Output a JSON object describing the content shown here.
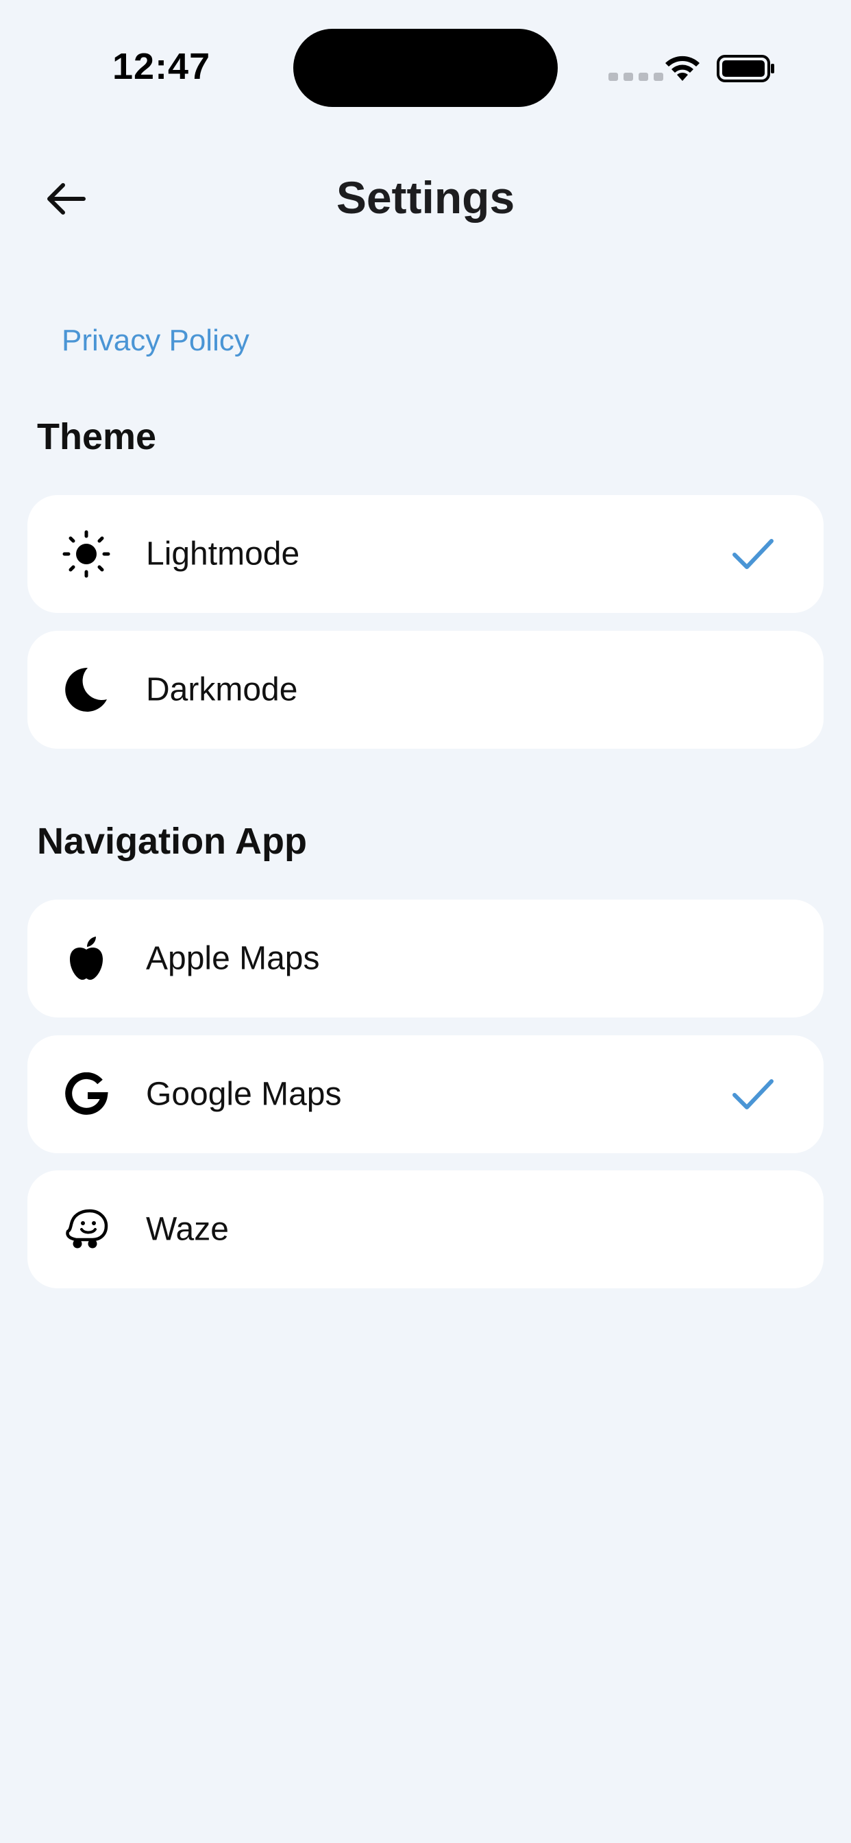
{
  "status_bar": {
    "time": "12:47"
  },
  "header": {
    "title": "Settings"
  },
  "privacy_policy": "Privacy Policy",
  "theme": {
    "title": "Theme",
    "options": [
      {
        "label": "Lightmode",
        "icon": "sun-icon",
        "selected": true
      },
      {
        "label": "Darkmode",
        "icon": "moon-icon",
        "selected": false
      }
    ]
  },
  "navigation": {
    "title": "Navigation App",
    "options": [
      {
        "label": "Apple Maps",
        "icon": "apple-icon",
        "selected": false
      },
      {
        "label": "Google Maps",
        "icon": "google-icon",
        "selected": true
      },
      {
        "label": "Waze",
        "icon": "waze-icon",
        "selected": false
      }
    ]
  },
  "colors": {
    "background": "#f1f5fa",
    "card": "#ffffff",
    "accent": "#4a95d5",
    "text": "#111111"
  }
}
